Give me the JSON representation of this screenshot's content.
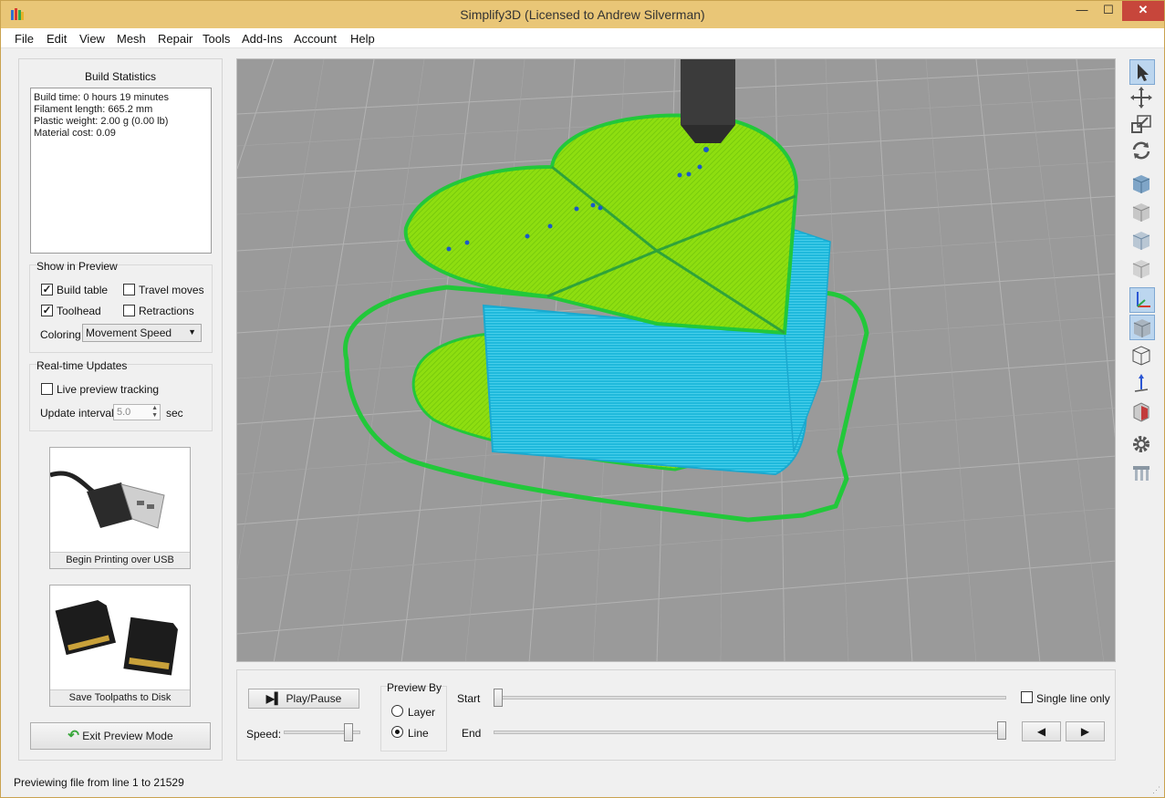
{
  "window": {
    "title": "Simplify3D (Licensed to Andrew Silverman)",
    "minimize_glyph": "—",
    "maximize_glyph": "☐",
    "close_glyph": "✕"
  },
  "menu": [
    "File",
    "Edit",
    "View",
    "Mesh",
    "Repair",
    "Tools",
    "Add-Ins",
    "Account",
    "Help"
  ],
  "build_statistics": {
    "title": "Build Statistics",
    "lines": [
      "Build time: 0 hours 19 minutes",
      "Filament length: 665.2 mm",
      "Plastic weight: 2.00 g (0.00 lb)",
      "Material cost: 0.09"
    ]
  },
  "show_in_preview": {
    "title": "Show in Preview",
    "build_table": {
      "label": "Build table",
      "checked": true
    },
    "travel_moves": {
      "label": "Travel moves",
      "checked": false
    },
    "toolhead": {
      "label": "Toolhead",
      "checked": true
    },
    "retractions": {
      "label": "Retractions",
      "checked": false
    },
    "coloring_label": "Coloring",
    "coloring_value": "Movement Speed"
  },
  "realtime_updates": {
    "title": "Real-time Updates",
    "live_tracking": {
      "label": "Live preview tracking",
      "checked": false
    },
    "update_interval_label": "Update interval",
    "update_interval_value": "5.0",
    "update_interval_unit": "sec"
  },
  "actions": {
    "usb_label": "Begin Printing over USB",
    "disk_label": "Save Toolpaths to Disk",
    "exit_label": "Exit Preview Mode"
  },
  "playback": {
    "play_pause_label": "Play/Pause",
    "speed_label": "Speed:",
    "speed_level": 0.85,
    "preview_by_title": "Preview By",
    "layer_label": "Layer",
    "line_label": "Line",
    "selected": "Line",
    "start_label": "Start",
    "end_label": "End",
    "start_level": 0.0,
    "end_level": 1.0,
    "single_line_label": "Single line only",
    "single_line_checked": false
  },
  "status": {
    "text": "Previewing file from line 1 to 21529"
  },
  "colors": {
    "titlebar": "#e9c677",
    "viewport": "#9a9a9a",
    "outer_perimeter": "#22c83a",
    "top_fill": "#8ede10",
    "slow_moves": "#1fc4e2",
    "toolhead": "#3b3b3b",
    "toolbar_active": "#bcd6ef"
  }
}
